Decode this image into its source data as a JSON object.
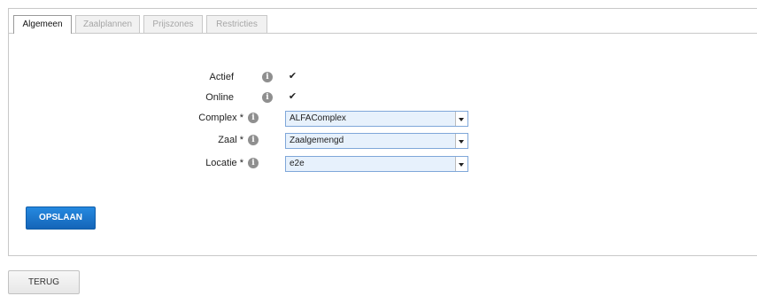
{
  "tabs": [
    {
      "label": "Algemeen",
      "active": true
    },
    {
      "label": "Zaalplannen",
      "active": false
    },
    {
      "label": "Prijszones",
      "active": false
    },
    {
      "label": "Restricties",
      "active": false
    }
  ],
  "form": {
    "actief": {
      "label": "Actief",
      "checked": true
    },
    "online": {
      "label": "Online",
      "checked": true
    },
    "complex": {
      "label": "Complex *",
      "value": "ALFAComplex"
    },
    "zaal": {
      "label": "Zaal *",
      "value": "Zaalgemengd"
    },
    "locatie": {
      "label": "Locatie *",
      "value": "e2e"
    }
  },
  "info_glyph": "i",
  "check_glyph": "✔",
  "buttons": {
    "save": "OPSLAAN",
    "back": "TERUG"
  },
  "colors": {
    "primary": "#1a74cc",
    "select_bg": "#e7f1fc",
    "select_border": "#7fa7d9"
  }
}
